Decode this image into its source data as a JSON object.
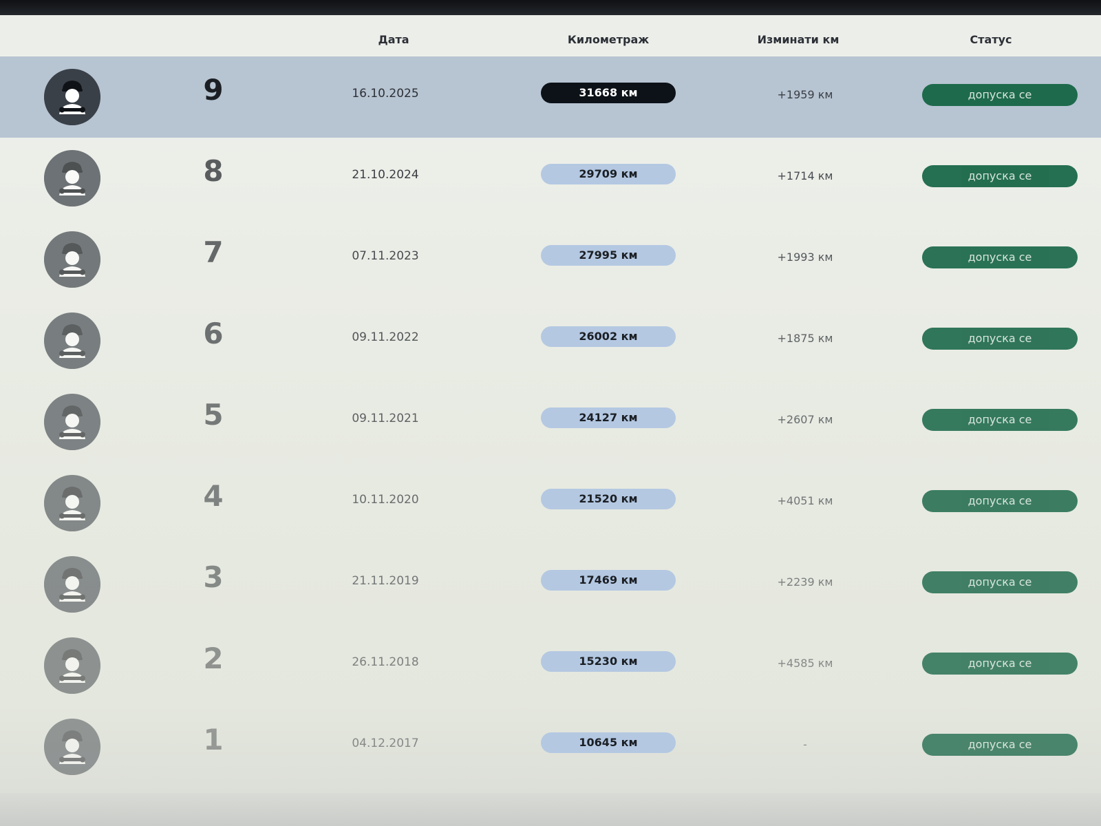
{
  "columns": {
    "date": "Дата",
    "mileage": "Километраж",
    "traveled": "Изминати км",
    "status": "Статус"
  },
  "rows": [
    {
      "number": "9",
      "date": "16.10.2025",
      "mileage": "31668 км",
      "delta": "+1959 км",
      "status": "допуска се",
      "highlighted": true
    },
    {
      "number": "8",
      "date": "21.10.2024",
      "mileage": "29709 км",
      "delta": "+1714 км",
      "status": "допуска се"
    },
    {
      "number": "7",
      "date": "07.11.2023",
      "mileage": "27995 км",
      "delta": "+1993 км",
      "status": "допуска се"
    },
    {
      "number": "6",
      "date": "09.11.2022",
      "mileage": "26002 км",
      "delta": "+1875 км",
      "status": "допуска се"
    },
    {
      "number": "5",
      "date": "09.11.2021",
      "mileage": "24127 км",
      "delta": "+2607 км",
      "status": "допуска се"
    },
    {
      "number": "4",
      "date": "10.11.2020",
      "mileage": "21520 км",
      "delta": "+4051 км",
      "status": "допуска се"
    },
    {
      "number": "3",
      "date": "21.11.2019",
      "mileage": "17469 км",
      "delta": "+2239 км",
      "status": "допуска се"
    },
    {
      "number": "2",
      "date": "26.11.2018",
      "mileage": "15230 км",
      "delta": "+4585 км",
      "status": "допуска се"
    },
    {
      "number": "1",
      "date": "04.12.2017",
      "mileage": "10645 км",
      "delta": "-",
      "status": "допуска се"
    }
  ],
  "colors": {
    "status_green": "#1e6a4c",
    "pill_blue": "#b4c8e2",
    "pill_active": "#0d1218",
    "highlight_row": "#b7c4d2"
  },
  "icons": {
    "avatar": "mechanic-icon"
  }
}
